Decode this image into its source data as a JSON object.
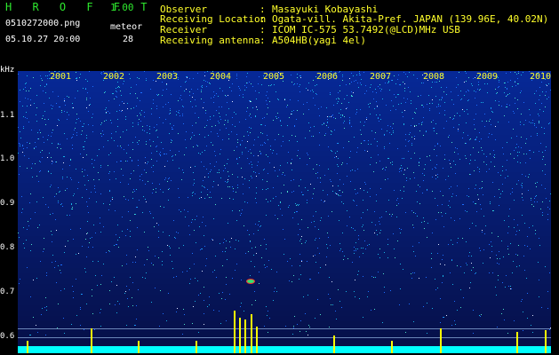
{
  "header": {
    "app_title": "H R O F F T",
    "app_version": "1.00",
    "file_name": "0510272000.png",
    "meteor_label": "meteor",
    "datetime": "05.10.27 20:00",
    "meteor_count": "28"
  },
  "info": [
    {
      "key": "Observer",
      "colon": ":",
      "value": "Masayuki Kobayashi"
    },
    {
      "key": "Receiving Location",
      "colon": ":",
      "value": "Ogata-vill. Akita-Pref. JAPAN (139.96E, 40.02N)"
    },
    {
      "key": "Receiver",
      "colon": ":",
      "value": "ICOM IC-575 53.7492(@LCD)MHz USB"
    },
    {
      "key": "Receiving antenna",
      "colon": ":",
      "value": "A504HB(yagi 4el)"
    }
  ],
  "axis": {
    "unit": "kHz",
    "y_ticks": [
      "1.1",
      "1.0",
      "0.9",
      "0.8",
      "0.7",
      "0.6"
    ],
    "x_ticks": [
      "2001",
      "2002",
      "2003",
      "2004",
      "2005",
      "2006",
      "2007",
      "2008",
      "2009",
      "2010"
    ]
  },
  "colors": {
    "background": "#000000",
    "header_green": "#2ee82e",
    "header_yellow": "#ffff2a",
    "spectrogram_base": "#061c66",
    "noise_floor": "#00ffff",
    "meteor_echo": "#ffff00"
  }
}
